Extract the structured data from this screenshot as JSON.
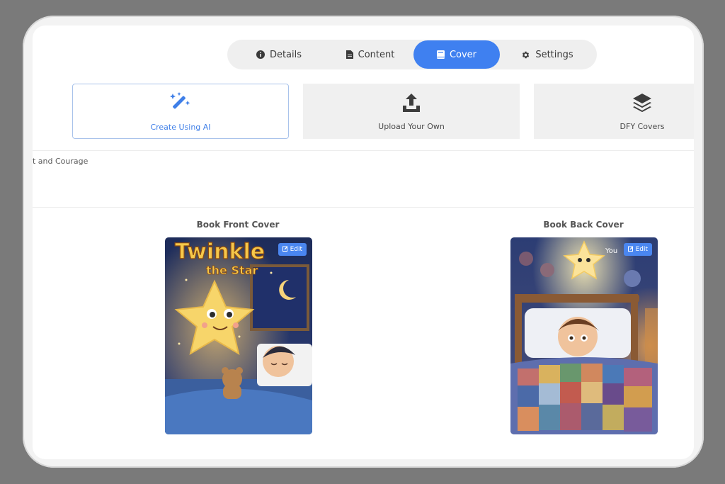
{
  "tabs": [
    {
      "label": "Details",
      "icon": "info-icon"
    },
    {
      "label": "Content",
      "icon": "document-icon"
    },
    {
      "label": "Cover",
      "icon": "book-icon",
      "active": true
    },
    {
      "label": "Settings",
      "icon": "gear-icon"
    }
  ],
  "cover_options": [
    {
      "label": "Create Using AI",
      "icon": "magic-wand-icon",
      "selected": true
    },
    {
      "label": "Upload Your Own",
      "icon": "upload-icon"
    },
    {
      "label": "DFY Covers",
      "icon": "layers-icon"
    }
  ],
  "book_title_fragment": "t and Courage",
  "front_cover": {
    "label": "Book Front Cover",
    "edit_label": "Edit",
    "artwork_title": "Twinkle",
    "artwork_subtitle": "the Star"
  },
  "back_cover": {
    "label": "Book Back Cover",
    "edit_label": "Edit",
    "artwork_text": "You"
  },
  "colors": {
    "accent": "#3f80f0",
    "frame_bg": "#7a7a7a"
  }
}
